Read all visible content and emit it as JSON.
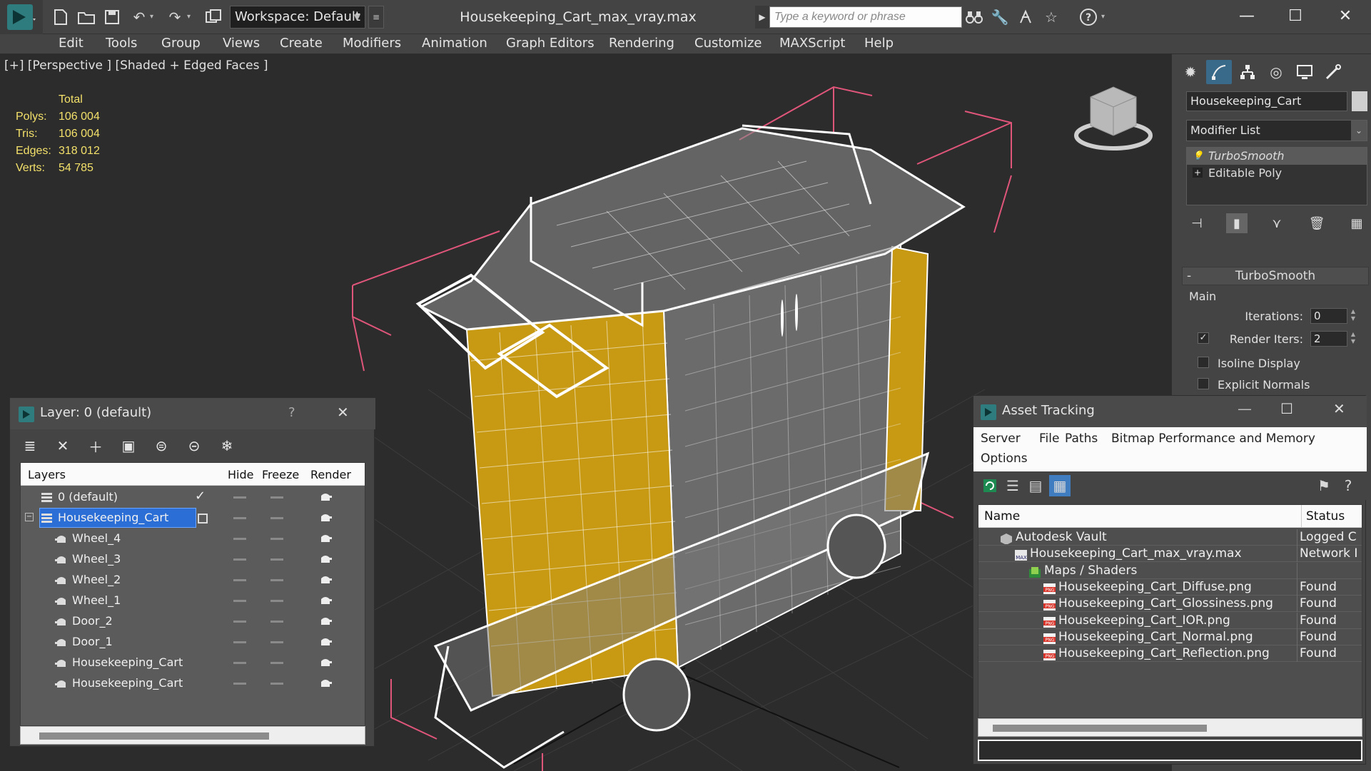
{
  "app": {
    "workspace_label": "Workspace: Default",
    "document_title": "Housekeeping_Cart_max_vray.max",
    "search_placeholder": "Type a keyword or phrase"
  },
  "menu": [
    "Edit",
    "Tools",
    "Group",
    "Views",
    "Create",
    "Modifiers",
    "Animation",
    "Graph Editors",
    "Rendering",
    "Customize",
    "MAXScript",
    "Help"
  ],
  "viewport": {
    "label": "[+] [Perspective ] [Shaded + Edged Faces ]",
    "stats": {
      "header": "Total",
      "rows": [
        {
          "key": "Polys:",
          "value": "106 004"
        },
        {
          "key": "Tris:",
          "value": "106 004"
        },
        {
          "key": "Edges:",
          "value": "318 012"
        },
        {
          "key": "Verts:",
          "value": "54 785"
        }
      ]
    }
  },
  "command_panel": {
    "object_name": "Housekeeping_Cart",
    "modifier_list": "Modifier List",
    "stack": [
      "TurboSmooth",
      "Editable Poly"
    ],
    "rollout": {
      "title": "TurboSmooth",
      "group": "Main",
      "iterations_label": "Iterations:",
      "iterations_value": "0",
      "render_iters_label": "Render Iters:",
      "render_iters_value": "2",
      "render_iters_checked": true,
      "isoline_label": "Isoline Display",
      "isoline_checked": false,
      "explicit_normals_label": "Explicit Normals",
      "explicit_normals_checked": false
    }
  },
  "layer_explorer": {
    "title": "Layer: 0 (default)",
    "help": "?",
    "columns": [
      "Layers",
      "Hide",
      "Freeze",
      "Render"
    ],
    "rows": [
      {
        "name": "0 (default)",
        "level": 0,
        "type": "layer",
        "current": true
      },
      {
        "name": "Housekeeping_Cart",
        "level": 0,
        "type": "layer",
        "selected": true,
        "expanded": true
      },
      {
        "name": "Wheel_4",
        "level": 1,
        "type": "object"
      },
      {
        "name": "Wheel_3",
        "level": 1,
        "type": "object"
      },
      {
        "name": "Wheel_2",
        "level": 1,
        "type": "object"
      },
      {
        "name": "Wheel_1",
        "level": 1,
        "type": "object"
      },
      {
        "name": "Door_2",
        "level": 1,
        "type": "object"
      },
      {
        "name": "Door_1",
        "level": 1,
        "type": "object"
      },
      {
        "name": "Housekeeping_Cart",
        "level": 1,
        "type": "object"
      },
      {
        "name": "Housekeeping_Cart",
        "level": 1,
        "type": "object"
      }
    ]
  },
  "asset_tracking": {
    "title": "Asset Tracking",
    "menu": [
      "Server",
      "File",
      "Paths",
      "Bitmap Performance and Memory",
      "Options"
    ],
    "columns": [
      "Name",
      "Status"
    ],
    "rows": [
      {
        "name": "Autodesk Vault",
        "status": "Logged C",
        "level": 0,
        "icon": "vault"
      },
      {
        "name": "Housekeeping_Cart_max_vray.max",
        "status": "Network I",
        "level": 1,
        "icon": "max"
      },
      {
        "name": "Maps / Shaders",
        "status": "",
        "level": 2,
        "icon": "folder"
      },
      {
        "name": "Housekeeping_Cart_Diffuse.png",
        "status": "Found",
        "level": 3,
        "icon": "png"
      },
      {
        "name": "Housekeeping_Cart_Glossiness.png",
        "status": "Found",
        "level": 3,
        "icon": "png"
      },
      {
        "name": "Housekeeping_Cart_IOR.png",
        "status": "Found",
        "level": 3,
        "icon": "png"
      },
      {
        "name": "Housekeeping_Cart_Normal.png",
        "status": "Found",
        "level": 3,
        "icon": "png"
      },
      {
        "name": "Housekeeping_Cart_Reflection.png",
        "status": "Found",
        "level": 3,
        "icon": "png"
      }
    ]
  },
  "colors": {
    "stats_text": "#f3e06a",
    "selection": "#2b6ed6",
    "bounding_box": "#e0557a",
    "fabric": "#c89a14",
    "wireframe": "#ffffff"
  }
}
